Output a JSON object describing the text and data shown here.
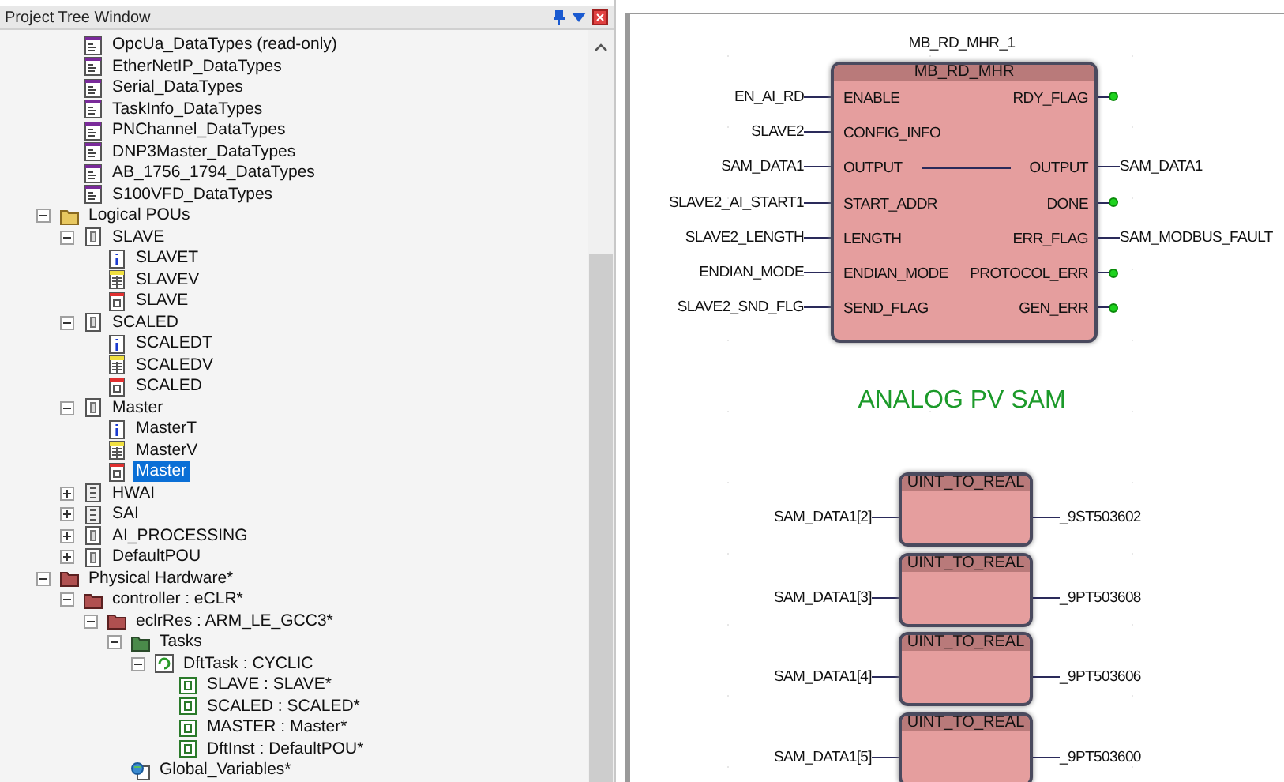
{
  "panel": {
    "title": "Project Tree Window"
  },
  "tree": {
    "hidden_parent_children": [
      {
        "label": "OpcUa_DataTypes (read-only)",
        "kind": "datatype",
        "selected": false
      },
      {
        "label": "EtherNetIP_DataTypes",
        "kind": "datatype",
        "selected": false
      },
      {
        "label": "Serial_DataTypes",
        "kind": "datatype",
        "selected": false
      },
      {
        "label": "TaskInfo_DataTypes",
        "kind": "datatype",
        "selected": false
      },
      {
        "label": "PNChannel_DataTypes",
        "kind": "datatype",
        "selected": false
      },
      {
        "label": "DNP3Master_DataTypes",
        "kind": "datatype",
        "selected": false
      },
      {
        "label": "AB_1756_1794_DataTypes",
        "kind": "datatype",
        "selected": false
      },
      {
        "label": "S100VFD_DataTypes",
        "kind": "datatype",
        "selected": false
      }
    ],
    "items": [
      {
        "label": "Logical POUs",
        "kind": "folder",
        "expanded": true,
        "selected": false,
        "children": [
          {
            "label": "SLAVE",
            "kind": "pou",
            "expanded": true,
            "selected": false,
            "children": [
              {
                "label": "SLAVET",
                "kind": "info",
                "selected": false
              },
              {
                "label": "SLAVEV",
                "kind": "vars",
                "selected": false
              },
              {
                "label": "SLAVE",
                "kind": "code",
                "selected": false
              }
            ]
          },
          {
            "label": "SCALED",
            "kind": "pou",
            "expanded": true,
            "selected": false,
            "children": [
              {
                "label": "SCALEDT",
                "kind": "info",
                "selected": false
              },
              {
                "label": "SCALEDV",
                "kind": "vars",
                "selected": false
              },
              {
                "label": "SCALED",
                "kind": "code",
                "selected": false
              }
            ]
          },
          {
            "label": "Master",
            "kind": "pou",
            "expanded": true,
            "selected": false,
            "children": [
              {
                "label": "MasterT",
                "kind": "info",
                "selected": false
              },
              {
                "label": "MasterV",
                "kind": "vars",
                "selected": false
              },
              {
                "label": "Master",
                "kind": "code",
                "selected": true
              }
            ]
          },
          {
            "label": "HWAI",
            "kind": "pou-group",
            "expanded": false,
            "selected": false
          },
          {
            "label": "SAI",
            "kind": "pou-group",
            "expanded": false,
            "selected": false
          },
          {
            "label": "AI_PROCESSING",
            "kind": "pou",
            "expanded": false,
            "selected": false
          },
          {
            "label": "DefaultPOU",
            "kind": "pou",
            "expanded": false,
            "selected": false
          }
        ]
      },
      {
        "label": "Physical Hardware*",
        "kind": "hw-folder",
        "expanded": true,
        "selected": false,
        "children": [
          {
            "label": "controller : eCLR*",
            "kind": "hw-folder",
            "expanded": true,
            "selected": false,
            "children": [
              {
                "label": "eclrRes : ARM_LE_GCC3*",
                "kind": "hw-folder",
                "expanded": true,
                "selected": false,
                "children": [
                  {
                    "label": "Tasks",
                    "kind": "task-folder",
                    "expanded": true,
                    "selected": false,
                    "children": [
                      {
                        "label": "DftTask : CYCLIC",
                        "kind": "task",
                        "expanded": true,
                        "selected": false,
                        "children": [
                          {
                            "label": "SLAVE : SLAVE*",
                            "kind": "program",
                            "selected": false
                          },
                          {
                            "label": "SCALED : SCALED*",
                            "kind": "program",
                            "selected": false
                          },
                          {
                            "label": "MASTER : Master*",
                            "kind": "program",
                            "selected": false
                          },
                          {
                            "label": "DftInst : DefaultPOU*",
                            "kind": "program",
                            "selected": false
                          }
                        ]
                      }
                    ]
                  },
                  {
                    "label": "Global_Variables*",
                    "kind": "global",
                    "selected": false
                  }
                ]
              }
            ]
          }
        ]
      }
    ]
  },
  "diagram": {
    "block": {
      "instance": "MB_RD_MHR_1",
      "type": "MB_RD_MHR",
      "rows": [
        {
          "in_variable": "EN_AI_RD",
          "in_pin": "ENABLE",
          "out_pin": "RDY_FLAG",
          "through": false
        },
        {
          "in_variable": "SLAVE2",
          "in_pin": "CONFIG_INFO",
          "through": false
        },
        {
          "in_variable": "SAM_DATA1",
          "in_pin": "OUTPUT",
          "out_pin": "OUTPUT",
          "out_variable": "SAM_DATA1",
          "through": true
        },
        {
          "in_variable": "SLAVE2_AI_START1",
          "in_pin": "START_ADDR",
          "out_pin": "DONE",
          "through": false
        },
        {
          "in_variable": "SLAVE2_LENGTH",
          "in_pin": "LENGTH",
          "out_pin": "ERR_FLAG",
          "out_variable": "SAM_MODBUS_FAULT",
          "through": false
        },
        {
          "in_variable": "ENDIAN_MODE",
          "in_pin": "ENDIAN_MODE",
          "out_pin": "PROTOCOL_ERR",
          "through": false
        },
        {
          "in_variable": "SLAVE2_SND_FLG",
          "in_pin": "SEND_FLAG",
          "out_pin": "GEN_ERR",
          "through": false
        }
      ]
    },
    "heading": "ANALOG PV SAM",
    "converters": [
      {
        "type": "UINT_TO_REAL",
        "input": "SAM_DATA1[2]",
        "output": "_9ST503602"
      },
      {
        "type": "UINT_TO_REAL",
        "input": "SAM_DATA1[3]",
        "output": "_9PT503608"
      },
      {
        "type": "UINT_TO_REAL",
        "input": "SAM_DATA1[4]",
        "output": "_9PT503606"
      },
      {
        "type": "UINT_TO_REAL",
        "input": "SAM_DATA1[5]",
        "output": "_9PT503600"
      }
    ]
  }
}
